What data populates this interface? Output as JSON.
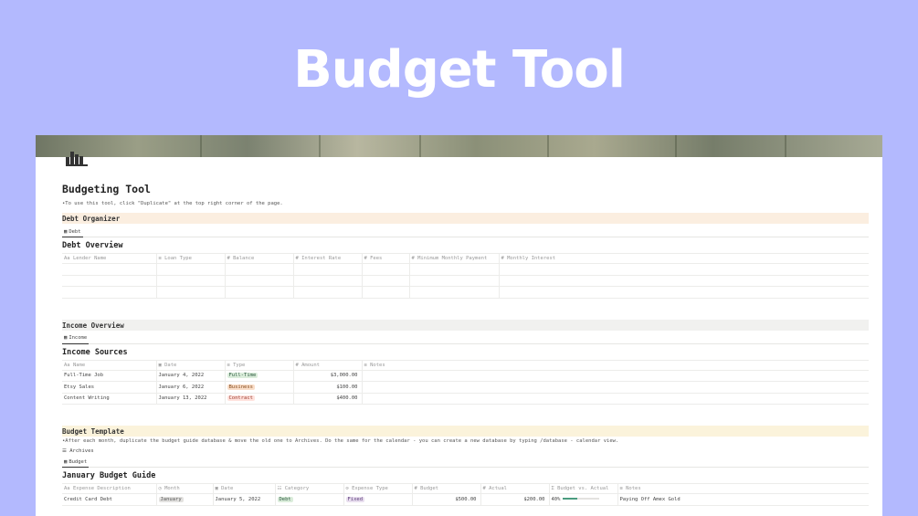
{
  "hero": {
    "title": "Budget Tool"
  },
  "page": {
    "title": "Budgeting Tool",
    "instruction": "•To use this tool, click \"Duplicate\" at the top right corner of the page."
  },
  "debt": {
    "section_title": "Debt Organizer",
    "tab_label": "Debt",
    "db_title": "Debt Overview",
    "columns": [
      "Lender Name",
      "Loan Type",
      "Balance",
      "Interest Rate",
      "Fees",
      "Minimum Monthly Payment",
      "Monthly Interest"
    ]
  },
  "income": {
    "section_title": "Income Overview",
    "tab_label": "Income",
    "db_title": "Income Sources",
    "columns": [
      "Name",
      "Date",
      "Type",
      "Amount",
      "Notes"
    ],
    "rows": [
      {
        "name": "Full-Time Job",
        "date": "January 4, 2022",
        "type": "Full-Time",
        "amount": "$3,000.00"
      },
      {
        "name": "Etsy Sales",
        "date": "January 6, 2022",
        "type": "Business",
        "amount": "$100.00"
      },
      {
        "name": "Content Writing",
        "date": "January 13, 2022",
        "type": "Contract",
        "amount": "$400.00"
      }
    ]
  },
  "budget": {
    "section_title": "Budget Template",
    "instruction": "•After each month, duplicate the budget guide database & move the old one to Archives. Do the same for the calendar - you can create a new database by typing /database - calendar view.",
    "archives_label": "Archives",
    "tab_label": "Budget",
    "db_title": "January Budget Guide",
    "columns": [
      "Expense Description",
      "Month",
      "Date",
      "Category",
      "Expense Type",
      "Budget",
      "Actual",
      "Budget vs. Actual",
      "Notes"
    ],
    "rows": [
      {
        "description": "Credit Card Debt",
        "month": "January",
        "date": "January 5, 2022",
        "category": "Debt",
        "expense_type": "Fixed",
        "budget": "$500.00",
        "actual": "$200.00",
        "ratio": "40%",
        "ratio_value": 0.4,
        "notes": "Paying Off Amex Gold"
      }
    ]
  },
  "colors": {
    "background": "#b3b9fe",
    "debt_header": "#fbeee0",
    "income_header": "#f1f1ef",
    "budget_header": "#fbf3db",
    "progress": "#4a9c7f"
  }
}
